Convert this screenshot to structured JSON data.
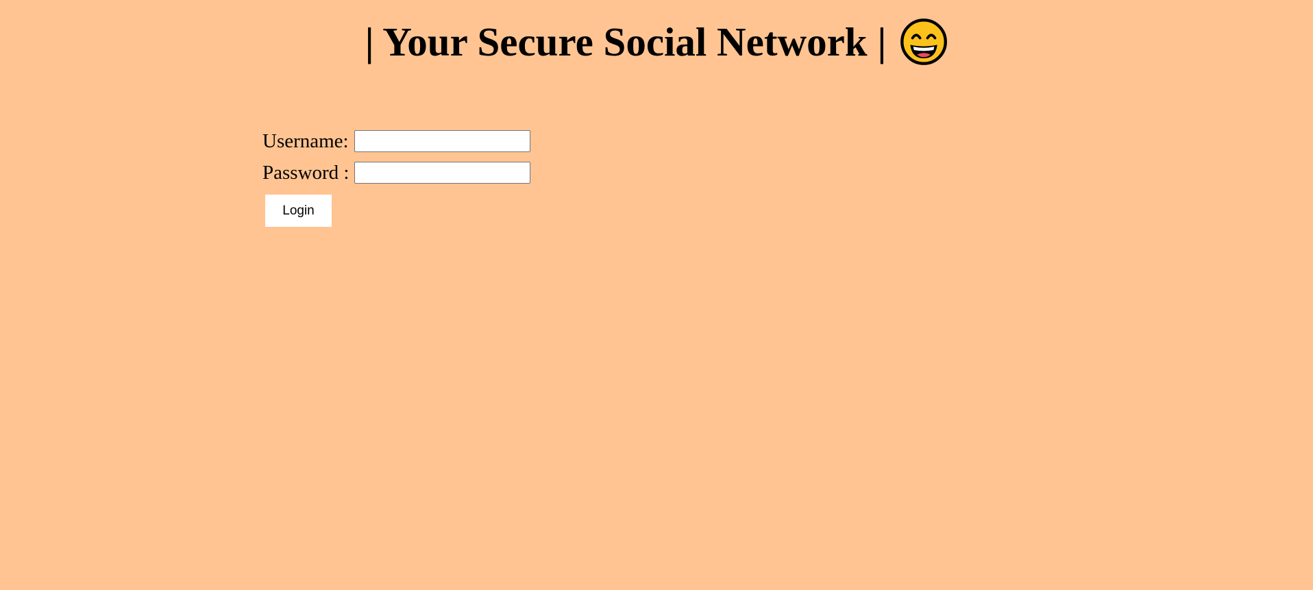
{
  "header": {
    "title": "| Your Secure Social Network |",
    "icon": "grinning-face-icon"
  },
  "login": {
    "username_label": "Username:",
    "username_value": "",
    "password_label": "Password :",
    "password_value": "",
    "button_label": "Login"
  },
  "colors": {
    "background": "#ffc491",
    "button_bg": "#ffffff",
    "emoji_face": "#fcc21b"
  }
}
